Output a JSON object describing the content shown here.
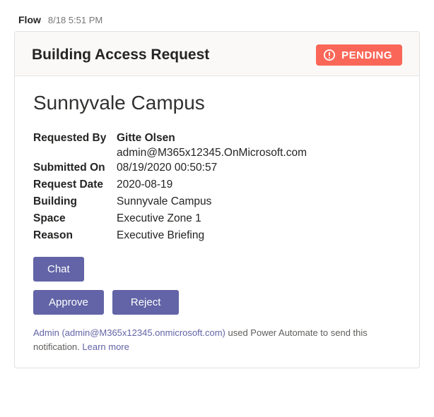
{
  "header": {
    "sender": "Flow",
    "timestamp": "8/18 5:51 PM"
  },
  "card": {
    "title": "Building Access Request",
    "status": "PENDING",
    "campus": "Sunnyvale Campus",
    "fields": {
      "requested_by_label": "Requested By",
      "requested_by_name": "Gitte Olsen",
      "requested_by_email": "admin@M365x12345.OnMicrosoft.com",
      "submitted_on_label": "Submitted On",
      "submitted_on_value": "08/19/2020 00:50:57",
      "request_date_label": "Request Date",
      "request_date_value": "2020-08-19",
      "building_label": "Building",
      "building_value": "Sunnyvale Campus",
      "space_label": "Space",
      "space_value": "Executive Zone 1",
      "reason_label": "Reason",
      "reason_value": "Executive Briefing"
    },
    "buttons": {
      "chat": "Chat",
      "approve": "Approve",
      "reject": "Reject"
    },
    "footer": {
      "sender_link": "Admin (admin@M365x12345.onmicrosoft.com)",
      "mid_text": " used Power Automate to send this notification. ",
      "learn_more": "Learn more"
    }
  }
}
